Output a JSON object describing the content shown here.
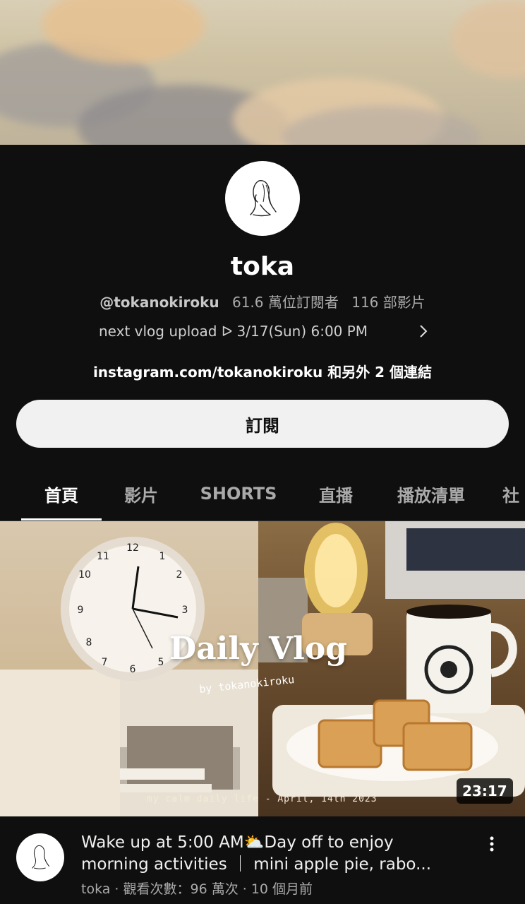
{
  "channel": {
    "name": "toka",
    "handle": "@tokanokiroku",
    "subscribers": "61.6 萬位訂閱者",
    "videos": "116 部影片",
    "description": "next vlog upload ᐅ 3/17(Sun) 6:00 PM",
    "links": "instagram.com/tokanokiroku 和另外 2 個連結",
    "subscribe_label": "訂閱"
  },
  "tabs": [
    {
      "label": "首頁",
      "active": true
    },
    {
      "label": "影片",
      "active": false
    },
    {
      "label": "SHORTS",
      "active": false
    },
    {
      "label": "直播",
      "active": false
    },
    {
      "label": "播放清單",
      "active": false
    },
    {
      "label": "社",
      "active": false
    }
  ],
  "featured_video": {
    "thumbnail_title": "Daily Vlog",
    "thumbnail_by": "by tokanokiroku",
    "thumbnail_caption": "my calm daily life - April, 14th 2023",
    "duration": "23:17",
    "title_line1": "Wake up at 5:00 AM⛅Day off to enjoy",
    "title_line2": "morning activities ｜ mini apple pie, rabo...",
    "meta": "toka · 觀看次數：96 萬次 · 10 個月前"
  },
  "icons": {
    "chevron": "chevron-right-icon",
    "more": "more-vert-icon",
    "avatar": "line-art-woman-avatar"
  }
}
